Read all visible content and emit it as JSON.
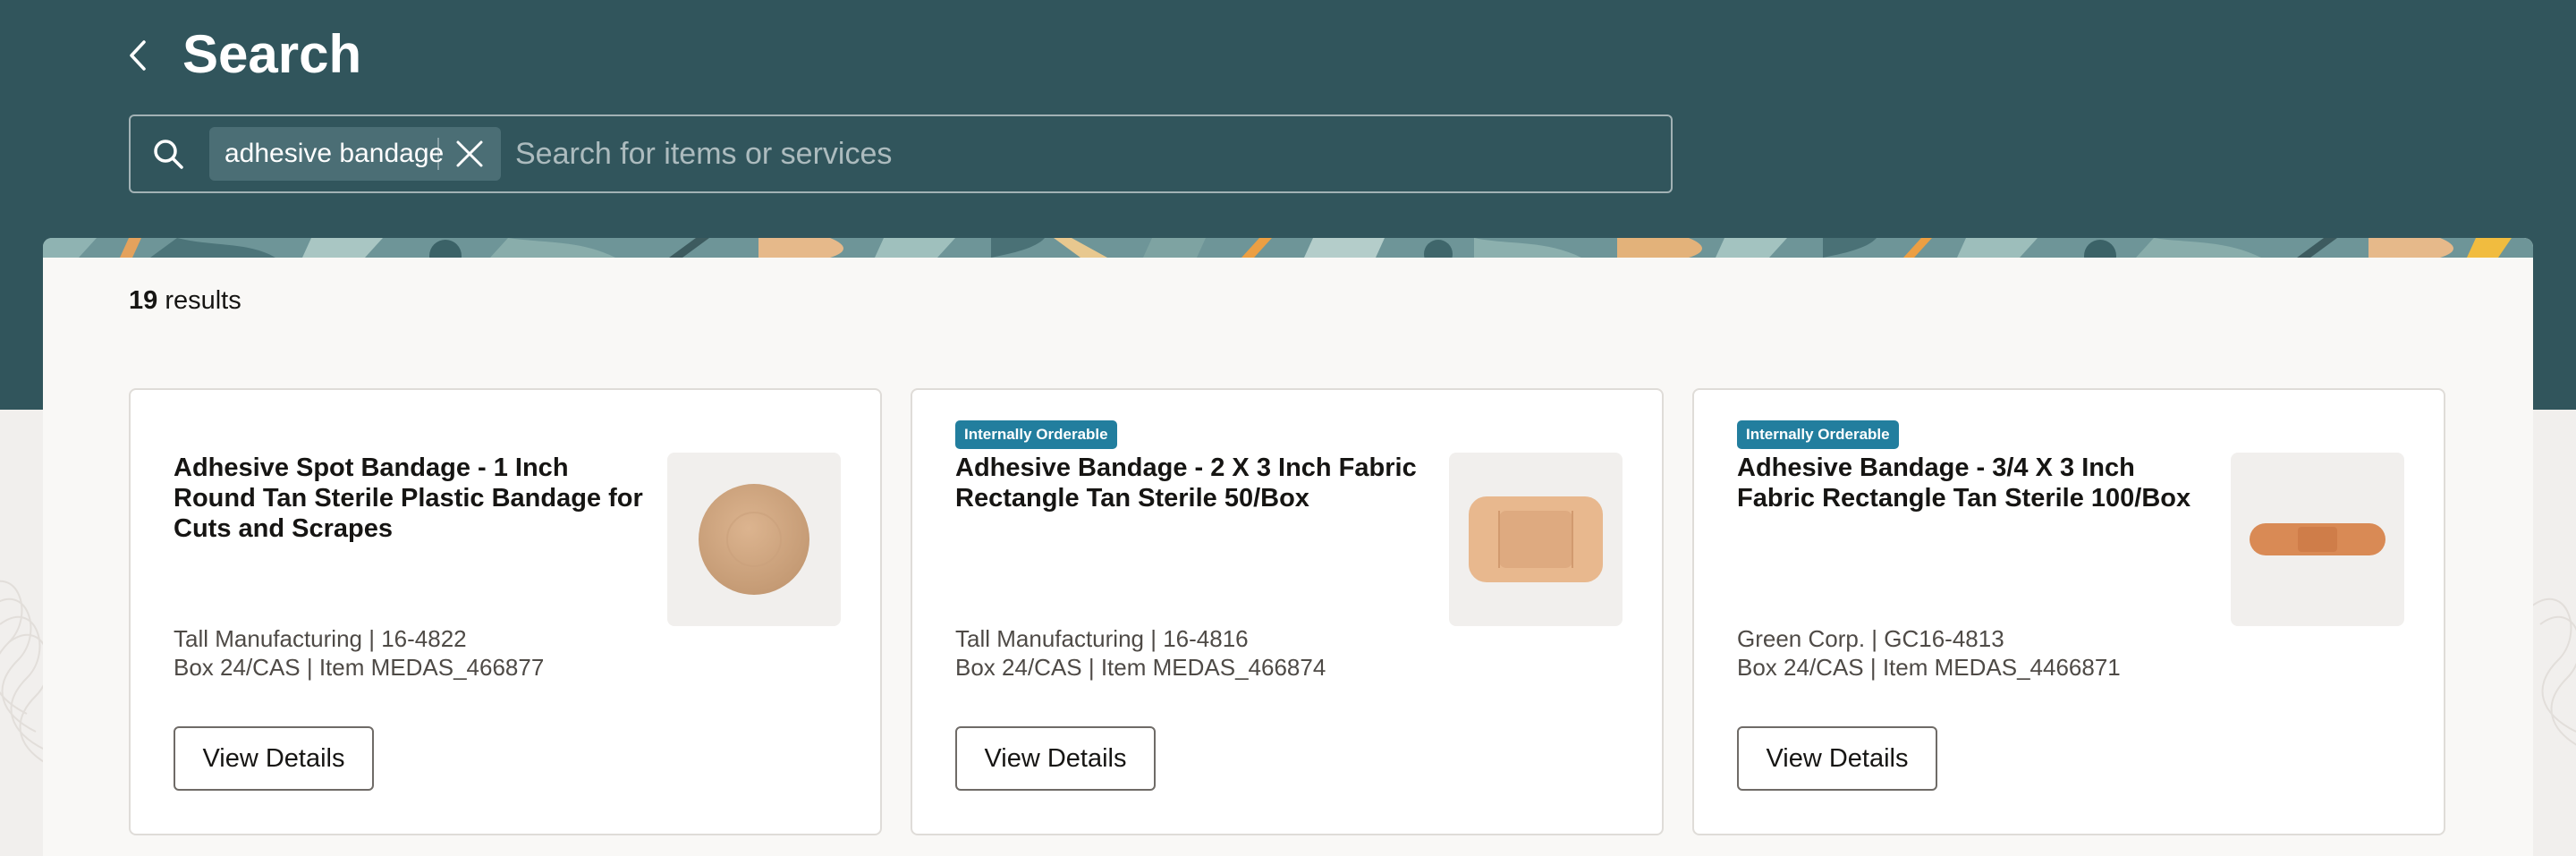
{
  "header": {
    "title": "Search",
    "back_icon": "chevron-left-icon"
  },
  "search": {
    "chip_label": "adhesive bandage",
    "placeholder": "Search for items or services",
    "value": ""
  },
  "results": {
    "count": "19",
    "label": "results"
  },
  "cards": [
    {
      "badge": "",
      "title": "Adhesive Spot Bandage - 1 Inch Round Tan Sterile Plastic Bandage for Cuts and Scrapes",
      "meta_line1": "Tall Manufacturing | 16-4822",
      "meta_line2": "Box 24/CAS | Item MEDAS_466877",
      "button_label": "View Details",
      "image": "round-bandage-image"
    },
    {
      "badge": "Internally Orderable",
      "title": "Adhesive Bandage - 2 X 3 Inch Fabric Rectangle Tan Sterile 50/Box",
      "meta_line1": "Tall Manufacturing | 16-4816",
      "meta_line2": "Box 24/CAS | Item MEDAS_466874",
      "button_label": "View Details",
      "image": "rectangle-bandage-image"
    },
    {
      "badge": "Internally Orderable",
      "title": "Adhesive Bandage - 3/4 X 3 Inch Fabric Rectangle Tan Sterile 100/Box",
      "meta_line1": "Green Corp. | GC16-4813",
      "meta_line2": "Box 24/CAS | Item MEDAS_4466871",
      "button_label": "View Details",
      "image": "strip-bandage-image"
    }
  ],
  "colors": {
    "header_bg": "#31555c",
    "badge_bg": "#227e9e",
    "page_bg": "#f1efed",
    "panel_bg": "#f9f8f6"
  }
}
